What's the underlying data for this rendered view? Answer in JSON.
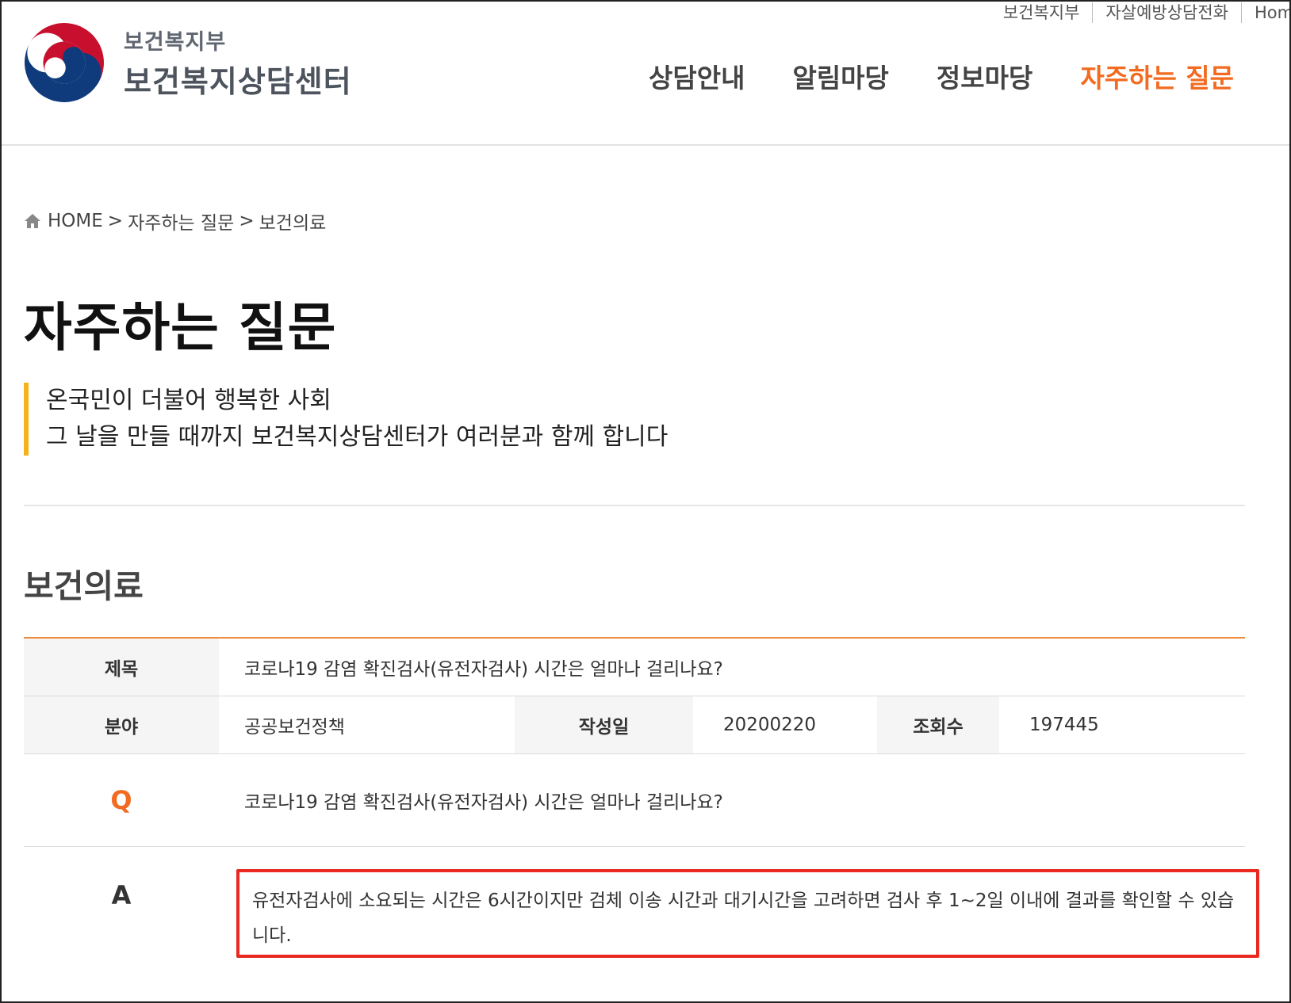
{
  "utility_links": [
    "보건복지부",
    "자살예방상담전화",
    "Home"
  ],
  "logo": {
    "sub": "보건복지부",
    "main": "보건복지상담센터"
  },
  "nav": [
    {
      "label": "상담안내",
      "active": false
    },
    {
      "label": "알림마당",
      "active": false
    },
    {
      "label": "정보마당",
      "active": false
    },
    {
      "label": "자주하는 질문",
      "active": true
    }
  ],
  "breadcrumb": {
    "home": "HOME",
    "sep": ">",
    "level1": "자주하는 질문",
    "level2": "보건의료"
  },
  "page_title": "자주하는 질문",
  "intro": {
    "line1": "온국민이 더불어 행복한 사회",
    "line2": "그 날을 만들 때까지 보건복지상담센터가 여러분과 함께 합니다"
  },
  "section_title": "보건의료",
  "faq": {
    "title_label": "제목",
    "title_value": "코로나19 감염 확진검사(유전자검사) 시간은 얼마나 걸리나요?",
    "field_label": "분야",
    "field_value": "공공보건정책",
    "date_label": "작성일",
    "date_value": "20200220",
    "views_label": "조회수",
    "views_value": "197445",
    "q_mark": "Q",
    "question": "코로나19 감염 확진검사(유전자검사) 시간은 얼마나 걸리나요?",
    "a_mark": "A",
    "answer": "유전자검사에 소요되는 시간은 6시간이지만 검체 이송 시간과 대기시간을 고려하면 검사 후 1~2일 이내에 결과를 확인할 수 있습니다."
  },
  "colors": {
    "accent": "#f26b21",
    "intro_bar": "#f5b21a",
    "highlight_box": "#ea2a20"
  }
}
